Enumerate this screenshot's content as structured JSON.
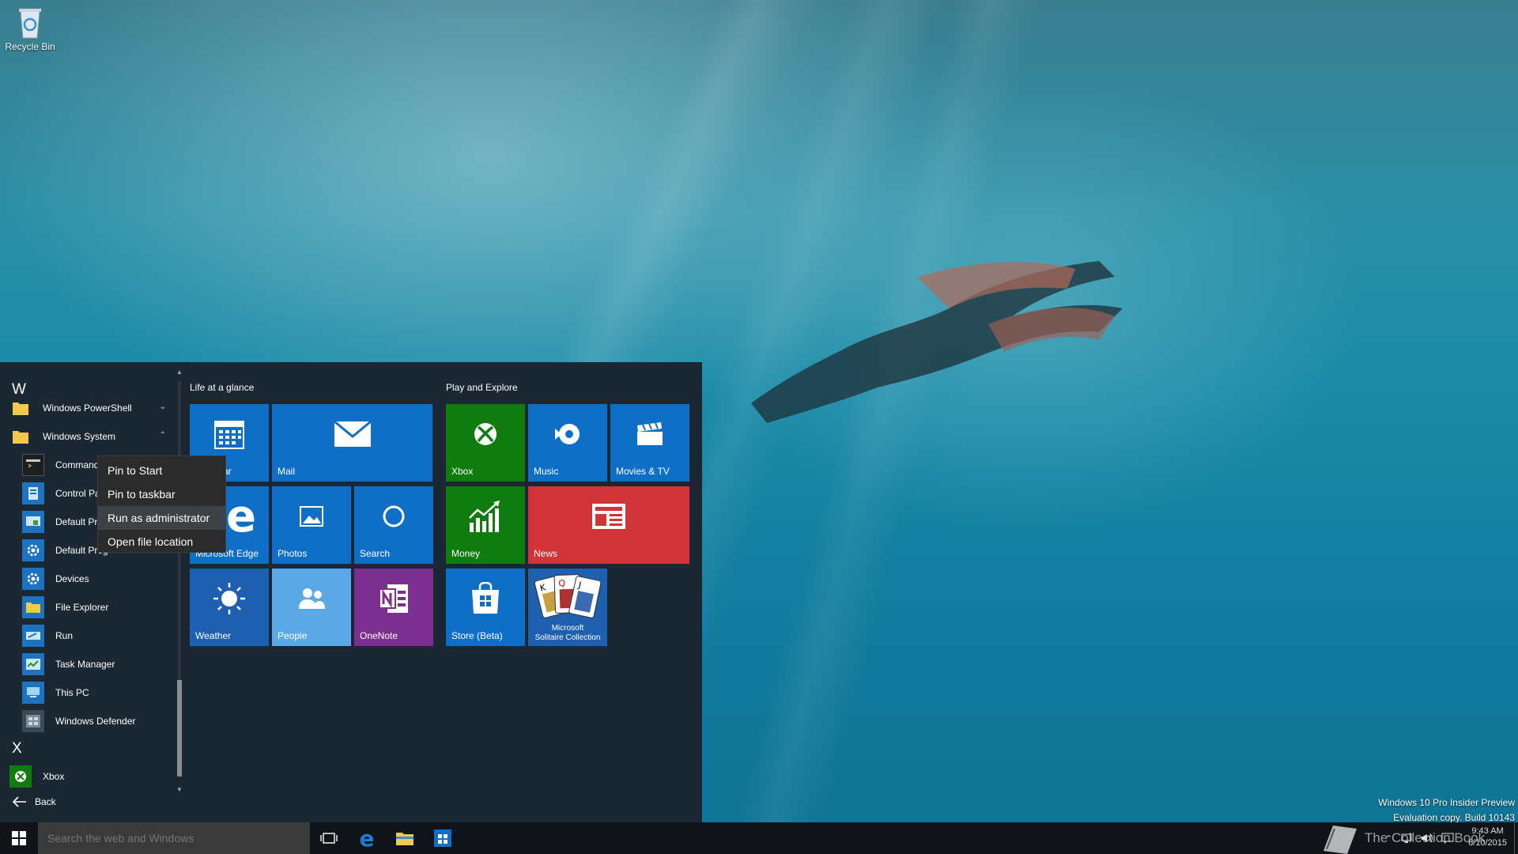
{
  "desktop": {
    "recycle_bin_label": "Recycle Bin",
    "watermark_line1": "Windows 10 Pro Insider Preview",
    "watermark_line2": "Evaluation copy. Build 10143",
    "overlay_logo_text": "The Collection Book"
  },
  "app_list": {
    "letter_w": "W",
    "letter_x": "X",
    "items": [
      {
        "label": "Windows PowerShell",
        "icon": "folder-icon"
      },
      {
        "label": "Windows System",
        "icon": "folder-icon"
      },
      {
        "label": "Command",
        "icon": "command-prompt-icon"
      },
      {
        "label": "Control Pa",
        "icon": "control-panel-icon"
      },
      {
        "label": "Default Pro",
        "icon": "default-programs-icon"
      },
      {
        "label": "Default Prog",
        "icon": "gear-icon"
      },
      {
        "label": "Devices",
        "icon": "gear-icon"
      },
      {
        "label": "File Explorer",
        "icon": "folder-icon"
      },
      {
        "label": "Run",
        "icon": "run-icon"
      },
      {
        "label": "Task Manager",
        "icon": "task-manager-icon"
      },
      {
        "label": "This PC",
        "icon": "computer-icon"
      },
      {
        "label": "Windows Defender",
        "icon": "windows-defender-icon"
      },
      {
        "label": "Xbox",
        "icon": "xbox-icon"
      }
    ],
    "back_label": "Back"
  },
  "context_menu": {
    "items": [
      "Pin to Start",
      "Pin to taskbar",
      "Run as administrator",
      "Open file location"
    ],
    "highlighted": "Run as administrator"
  },
  "tiles": {
    "group1_title": "Life at a glance",
    "group2_title": "Play and Explore",
    "calendar": "ar",
    "mail": "Mail",
    "edge": "Microsoft Edge",
    "photos": "Photos",
    "search": "Search",
    "weather": "Weather",
    "people": "People",
    "onenote": "OneNote",
    "xbox": "Xbox",
    "music": "Music",
    "movies": "Movies & TV",
    "money": "Money",
    "news": "News",
    "store": "Store (Beta)",
    "solitaire_line1": "Microsoft",
    "solitaire_line2": "Solitaire Collection"
  },
  "colors": {
    "tile_blue": "#0f6fc6",
    "tile_green": "#107c10",
    "tile_red": "#d13438",
    "tile_purple": "#7b2f8f",
    "tile_light_blue": "#5aa8e6",
    "tile_dark_blue": "#1e5fb0"
  },
  "taskbar": {
    "search_placeholder": "Search the web and Windows",
    "time": "9:43 AM",
    "date": "6/10/2015"
  }
}
